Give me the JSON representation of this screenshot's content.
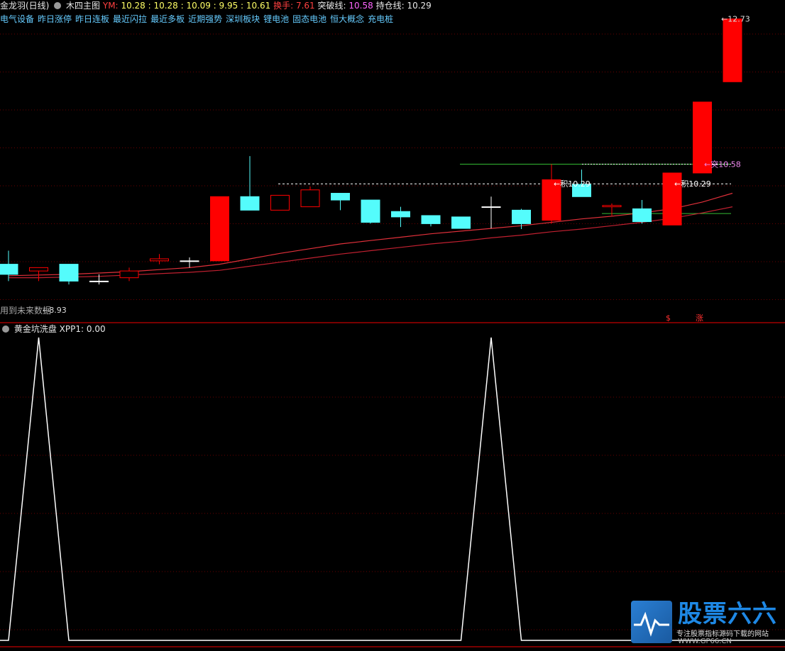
{
  "header": {
    "stock": "金龙羽(日线)",
    "main_chart": "木四主图",
    "ym_label": "YM:",
    "ym_values": "10.28 : 10.28 : 10.09 : 9.95 : 10.61",
    "turnover_label": "换手:",
    "turnover_value": "7.61",
    "breakout_label": "突破线:",
    "breakout_value": "10.58",
    "hold_label": "持仓线:",
    "hold_value": "10.29"
  },
  "concepts": [
    "电气设备",
    "昨日涨停",
    "昨日连板",
    "最近闪拉",
    "最近多板",
    "近期强势",
    "深圳板块",
    "锂电池",
    "固态电池",
    "恒大概念",
    "充电桩"
  ],
  "sub_panel": {
    "name": "黄金坑洗盘",
    "xpp_label": "XPP1:",
    "xpp_value": "0.00"
  },
  "future_note": "用到未来数据",
  "logo": {
    "brand": "股票六六",
    "tagline": "专注股票指标源码下载的网站",
    "url": "WWW.GP66.CN"
  },
  "chart_data": {
    "type": "candlestick",
    "candles": [
      {
        "o": 9.1,
        "h": 9.3,
        "l": 8.85,
        "c": 8.95
      },
      {
        "o": 9.0,
        "h": 9.05,
        "l": 8.85,
        "c": 9.05
      },
      {
        "o": 9.1,
        "h": 9.1,
        "l": 8.8,
        "c": 8.85
      },
      {
        "o": 8.85,
        "h": 8.95,
        "l": 8.8,
        "c": 8.85
      },
      {
        "o": 8.9,
        "h": 9.05,
        "l": 8.85,
        "c": 9.0
      },
      {
        "o": 9.15,
        "h": 9.25,
        "l": 9.1,
        "c": 9.18
      },
      {
        "o": 9.15,
        "h": 9.2,
        "l": 9.05,
        "c": 9.15
      },
      {
        "o": 9.15,
        "h": 10.1,
        "l": 9.15,
        "c": 10.1
      },
      {
        "o": 10.1,
        "h": 10.7,
        "l": 9.9,
        "c": 9.9
      },
      {
        "o": 9.9,
        "h": 10.12,
        "l": 9.9,
        "c": 10.12
      },
      {
        "o": 9.95,
        "h": 10.25,
        "l": 9.95,
        "c": 10.2
      },
      {
        "o": 10.15,
        "h": 10.15,
        "l": 9.9,
        "c": 10.05
      },
      {
        "o": 10.05,
        "h": 10.05,
        "l": 9.7,
        "c": 9.72
      },
      {
        "o": 9.88,
        "h": 9.95,
        "l": 9.65,
        "c": 9.8
      },
      {
        "o": 9.82,
        "h": 9.82,
        "l": 9.66,
        "c": 9.7
      },
      {
        "o": 9.8,
        "h": 9.8,
        "l": 9.63,
        "c": 9.63
      },
      {
        "o": 9.95,
        "h": 10.1,
        "l": 9.63,
        "c": 9.95
      },
      {
        "o": 9.9,
        "h": 9.92,
        "l": 9.62,
        "c": 9.7
      },
      {
        "o": 9.75,
        "h": 10.58,
        "l": 9.7,
        "c": 10.35
      },
      {
        "o": 10.28,
        "h": 10.5,
        "l": 10.1,
        "c": 10.1
      },
      {
        "o": 9.95,
        "h": 10.0,
        "l": 9.82,
        "c": 9.97
      },
      {
        "o": 9.92,
        "h": 10.05,
        "l": 9.7,
        "c": 9.73
      },
      {
        "o": 9.68,
        "h": 10.45,
        "l": 9.68,
        "c": 10.45
      },
      {
        "o": 10.45,
        "h": 11.5,
        "l": 10.45,
        "c": 11.5
      },
      {
        "o": 11.8,
        "h": 12.73,
        "l": 11.8,
        "c": 12.73
      }
    ],
    "ma1": [
      8.93,
      8.94,
      8.95,
      8.97,
      8.99,
      9.02,
      9.05,
      9.1,
      9.18,
      9.26,
      9.33,
      9.4,
      9.45,
      9.5,
      9.55,
      9.59,
      9.63,
      9.67,
      9.72,
      9.77,
      9.81,
      9.86,
      9.92,
      10.02,
      10.15
    ],
    "ma2": [
      8.9,
      8.9,
      8.91,
      8.92,
      8.94,
      8.96,
      8.98,
      9.01,
      9.07,
      9.13,
      9.19,
      9.25,
      9.3,
      9.35,
      9.4,
      9.44,
      9.49,
      9.53,
      9.58,
      9.62,
      9.67,
      9.72,
      9.78,
      9.86,
      9.95
    ],
    "breakout_line": {
      "value": 10.58,
      "label": "突10.58"
    },
    "hold_line": {
      "value": 10.29,
      "label": "积10.29",
      "mid_label": "积10.29"
    },
    "support_line": {
      "value": 9.85
    },
    "price_high_label": "12.73",
    "price_low_label": "8.93",
    "markers": [
      "$",
      "涨"
    ],
    "xpp1": [
      0,
      1,
      0,
      0,
      0,
      0,
      0,
      0,
      0,
      0,
      0,
      0,
      0,
      0,
      0,
      0,
      1,
      0,
      0,
      0,
      0,
      0,
      0,
      0,
      0
    ],
    "colors": {
      "up": "#ff0000",
      "down": "#54fcfc",
      "ma1": "#e0303a",
      "ma2": "#c02030",
      "grid": "#6a0000",
      "border": "#a00000"
    }
  }
}
